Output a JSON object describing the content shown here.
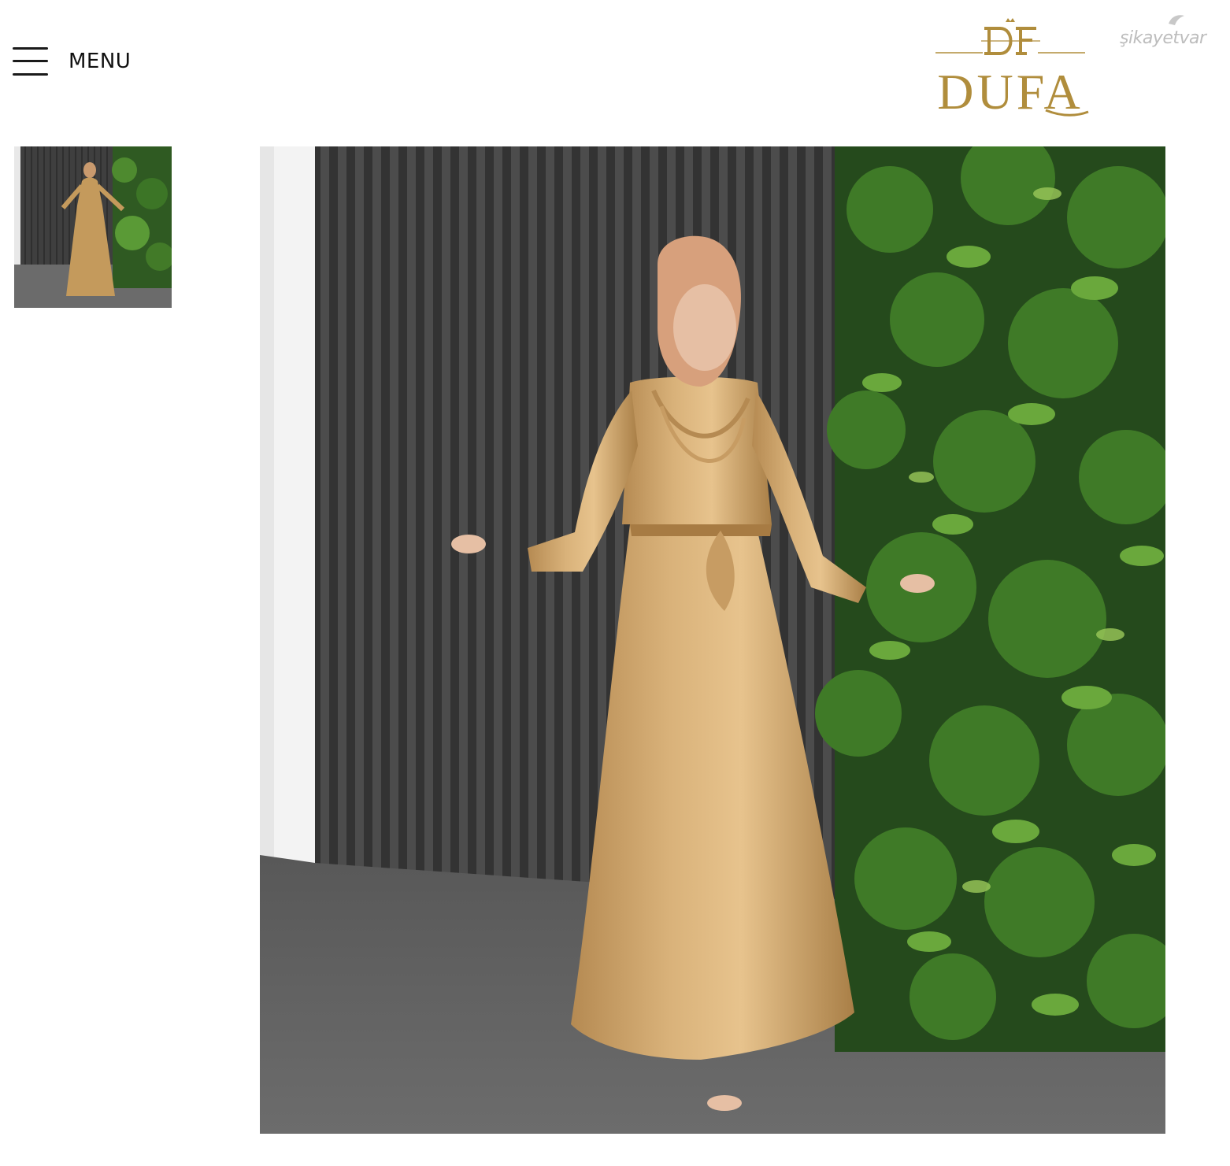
{
  "header": {
    "menu_label": "MENU",
    "logo_text": "DUFA",
    "badge_text": "şikayetvar"
  },
  "colors": {
    "gold": "#b08d3c",
    "text": "#111111",
    "badge_gray": "#bdbdbd"
  },
  "icons": {
    "menu": "hamburger-icon",
    "logo_mark": "dufa-monogram-icon",
    "badge_mark": "bird-icon"
  },
  "gallery": {
    "thumbnails_count": 1,
    "selected_index": 0
  }
}
